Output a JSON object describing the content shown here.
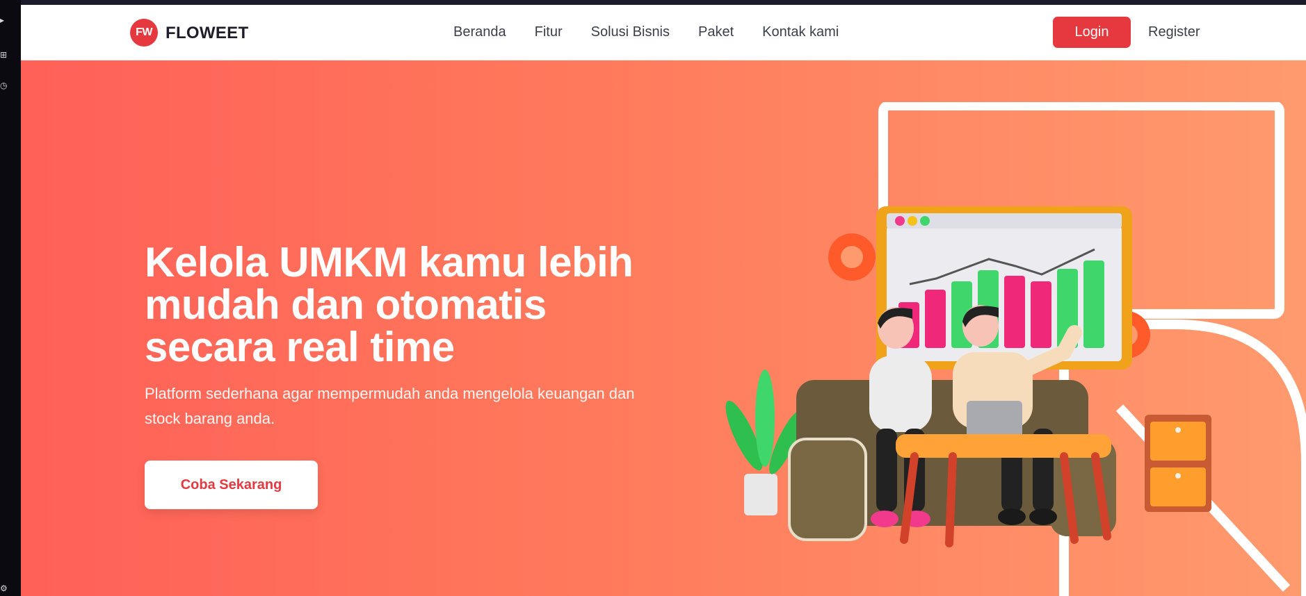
{
  "brand": {
    "badge": "FW",
    "name": "FLOWEET"
  },
  "nav": {
    "links": [
      "Beranda",
      "Fitur",
      "Solusi Bisnis",
      "Paket",
      "Kontak kami"
    ],
    "login_label": "Login",
    "register_label": "Register"
  },
  "hero": {
    "title": "Kelola UMKM kamu lebih mudah dan otomatis secara real time",
    "subtitle": "Platform sederhana agar mempermudah anda mengelola keuangan dan stock barang anda.",
    "cta_label": "Coba Sekarang"
  },
  "colors": {
    "accent": "#e5393f",
    "hero_start": "#ff6057",
    "hero_end": "#ff9a6e"
  },
  "icons": {
    "sidebar": [
      "arrow-icon",
      "contacts-icon",
      "history-icon",
      "settings-icon"
    ],
    "illustration": "business-analytics-illustration"
  }
}
